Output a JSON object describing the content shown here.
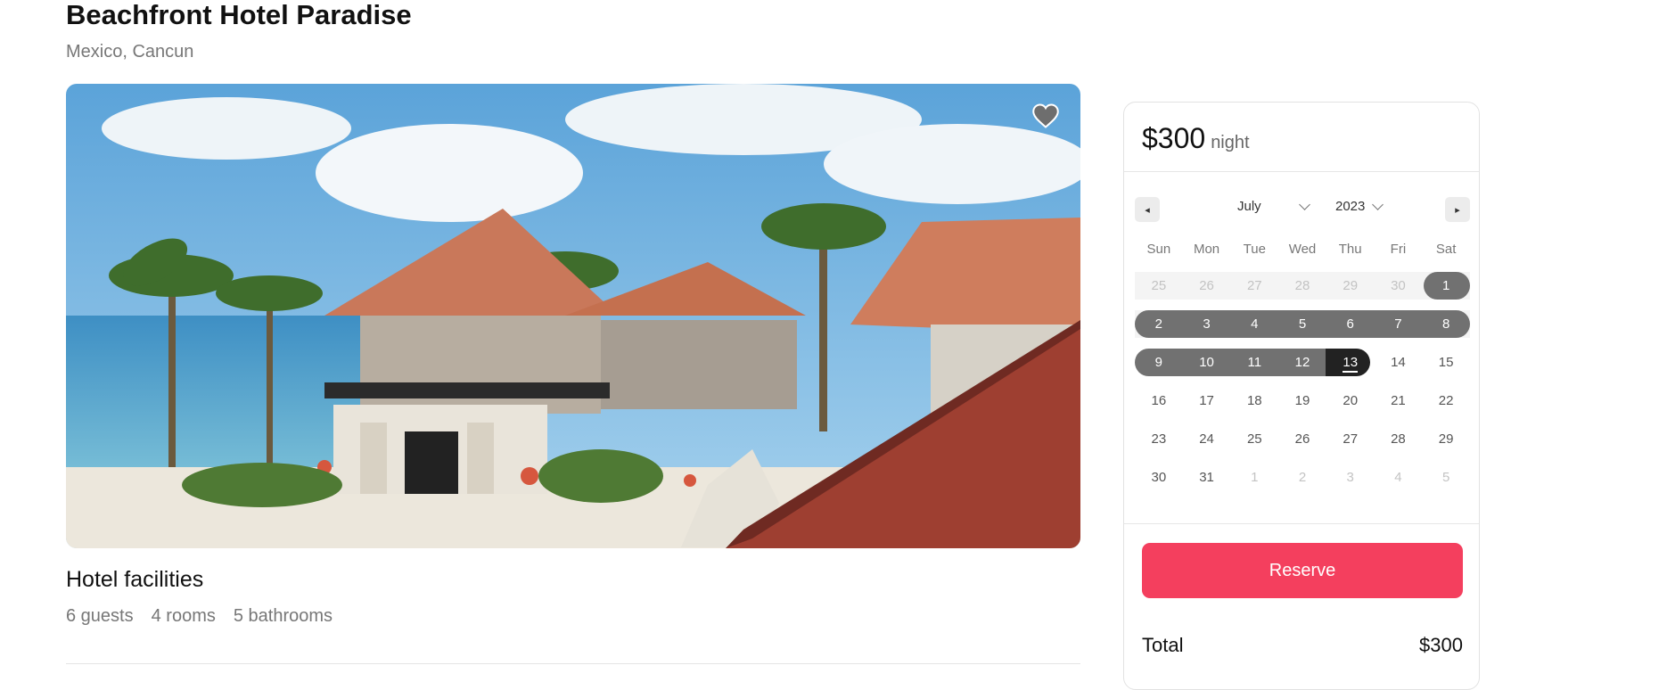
{
  "listing": {
    "title": "Beachfront Hotel Paradise",
    "location": "Mexico, Cancun",
    "favorite_icon": "heart-icon"
  },
  "facilities": {
    "title": "Hotel facilities",
    "guests": "6 guests",
    "rooms": "4 rooms",
    "bathrooms": "5 bathrooms"
  },
  "booking": {
    "price": "$300",
    "per_unit": "night",
    "reserve_label": "Reserve",
    "total_label": "Total",
    "total_value": "$300",
    "accent_color": "#f43f5e"
  },
  "calendar": {
    "prev_label": "◂",
    "next_label": "▸",
    "month": "July",
    "year": "2023",
    "weekdays": [
      "Sun",
      "Mon",
      "Tue",
      "Wed",
      "Thu",
      "Fri",
      "Sat"
    ],
    "weeks": [
      [
        "25",
        "26",
        "27",
        "28",
        "29",
        "30",
        "1"
      ],
      [
        "2",
        "3",
        "4",
        "5",
        "6",
        "7",
        "8"
      ],
      [
        "9",
        "10",
        "11",
        "12",
        "13",
        "14",
        "15"
      ],
      [
        "16",
        "17",
        "18",
        "19",
        "20",
        "21",
        "22"
      ],
      [
        "23",
        "24",
        "25",
        "26",
        "27",
        "28",
        "29"
      ],
      [
        "30",
        "31",
        "1",
        "2",
        "3",
        "4",
        "5"
      ]
    ]
  }
}
